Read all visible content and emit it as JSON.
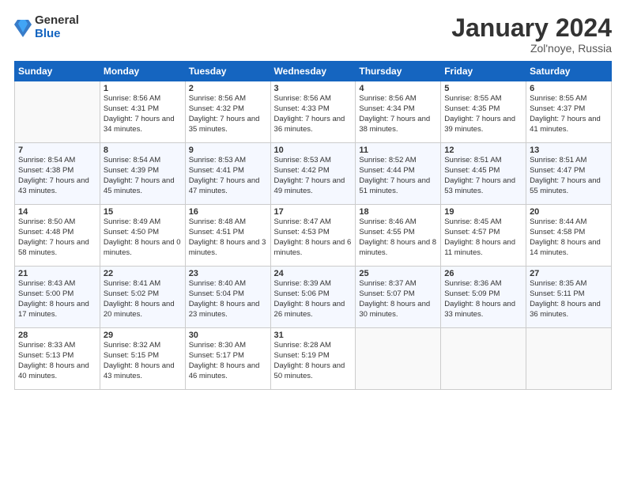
{
  "logo": {
    "general": "General",
    "blue": "Blue"
  },
  "title": "January 2024",
  "subtitle": "Zol'noye, Russia",
  "headers": [
    "Sunday",
    "Monday",
    "Tuesday",
    "Wednesday",
    "Thursday",
    "Friday",
    "Saturday"
  ],
  "weeks": [
    [
      {
        "day": "",
        "sunrise": "",
        "sunset": "",
        "daylight": "",
        "empty": true
      },
      {
        "day": "1",
        "sunrise": "Sunrise: 8:56 AM",
        "sunset": "Sunset: 4:31 PM",
        "daylight": "Daylight: 7 hours and 34 minutes."
      },
      {
        "day": "2",
        "sunrise": "Sunrise: 8:56 AM",
        "sunset": "Sunset: 4:32 PM",
        "daylight": "Daylight: 7 hours and 35 minutes."
      },
      {
        "day": "3",
        "sunrise": "Sunrise: 8:56 AM",
        "sunset": "Sunset: 4:33 PM",
        "daylight": "Daylight: 7 hours and 36 minutes."
      },
      {
        "day": "4",
        "sunrise": "Sunrise: 8:56 AM",
        "sunset": "Sunset: 4:34 PM",
        "daylight": "Daylight: 7 hours and 38 minutes."
      },
      {
        "day": "5",
        "sunrise": "Sunrise: 8:55 AM",
        "sunset": "Sunset: 4:35 PM",
        "daylight": "Daylight: 7 hours and 39 minutes."
      },
      {
        "day": "6",
        "sunrise": "Sunrise: 8:55 AM",
        "sunset": "Sunset: 4:37 PM",
        "daylight": "Daylight: 7 hours and 41 minutes."
      }
    ],
    [
      {
        "day": "7",
        "sunrise": "Sunrise: 8:54 AM",
        "sunset": "Sunset: 4:38 PM",
        "daylight": "Daylight: 7 hours and 43 minutes."
      },
      {
        "day": "8",
        "sunrise": "Sunrise: 8:54 AM",
        "sunset": "Sunset: 4:39 PM",
        "daylight": "Daylight: 7 hours and 45 minutes."
      },
      {
        "day": "9",
        "sunrise": "Sunrise: 8:53 AM",
        "sunset": "Sunset: 4:41 PM",
        "daylight": "Daylight: 7 hours and 47 minutes."
      },
      {
        "day": "10",
        "sunrise": "Sunrise: 8:53 AM",
        "sunset": "Sunset: 4:42 PM",
        "daylight": "Daylight: 7 hours and 49 minutes."
      },
      {
        "day": "11",
        "sunrise": "Sunrise: 8:52 AM",
        "sunset": "Sunset: 4:44 PM",
        "daylight": "Daylight: 7 hours and 51 minutes."
      },
      {
        "day": "12",
        "sunrise": "Sunrise: 8:51 AM",
        "sunset": "Sunset: 4:45 PM",
        "daylight": "Daylight: 7 hours and 53 minutes."
      },
      {
        "day": "13",
        "sunrise": "Sunrise: 8:51 AM",
        "sunset": "Sunset: 4:47 PM",
        "daylight": "Daylight: 7 hours and 55 minutes."
      }
    ],
    [
      {
        "day": "14",
        "sunrise": "Sunrise: 8:50 AM",
        "sunset": "Sunset: 4:48 PM",
        "daylight": "Daylight: 7 hours and 58 minutes."
      },
      {
        "day": "15",
        "sunrise": "Sunrise: 8:49 AM",
        "sunset": "Sunset: 4:50 PM",
        "daylight": "Daylight: 8 hours and 0 minutes."
      },
      {
        "day": "16",
        "sunrise": "Sunrise: 8:48 AM",
        "sunset": "Sunset: 4:51 PM",
        "daylight": "Daylight: 8 hours and 3 minutes."
      },
      {
        "day": "17",
        "sunrise": "Sunrise: 8:47 AM",
        "sunset": "Sunset: 4:53 PM",
        "daylight": "Daylight: 8 hours and 6 minutes."
      },
      {
        "day": "18",
        "sunrise": "Sunrise: 8:46 AM",
        "sunset": "Sunset: 4:55 PM",
        "daylight": "Daylight: 8 hours and 8 minutes."
      },
      {
        "day": "19",
        "sunrise": "Sunrise: 8:45 AM",
        "sunset": "Sunset: 4:57 PM",
        "daylight": "Daylight: 8 hours and 11 minutes."
      },
      {
        "day": "20",
        "sunrise": "Sunrise: 8:44 AM",
        "sunset": "Sunset: 4:58 PM",
        "daylight": "Daylight: 8 hours and 14 minutes."
      }
    ],
    [
      {
        "day": "21",
        "sunrise": "Sunrise: 8:43 AM",
        "sunset": "Sunset: 5:00 PM",
        "daylight": "Daylight: 8 hours and 17 minutes."
      },
      {
        "day": "22",
        "sunrise": "Sunrise: 8:41 AM",
        "sunset": "Sunset: 5:02 PM",
        "daylight": "Daylight: 8 hours and 20 minutes."
      },
      {
        "day": "23",
        "sunrise": "Sunrise: 8:40 AM",
        "sunset": "Sunset: 5:04 PM",
        "daylight": "Daylight: 8 hours and 23 minutes."
      },
      {
        "day": "24",
        "sunrise": "Sunrise: 8:39 AM",
        "sunset": "Sunset: 5:06 PM",
        "daylight": "Daylight: 8 hours and 26 minutes."
      },
      {
        "day": "25",
        "sunrise": "Sunrise: 8:37 AM",
        "sunset": "Sunset: 5:07 PM",
        "daylight": "Daylight: 8 hours and 30 minutes."
      },
      {
        "day": "26",
        "sunrise": "Sunrise: 8:36 AM",
        "sunset": "Sunset: 5:09 PM",
        "daylight": "Daylight: 8 hours and 33 minutes."
      },
      {
        "day": "27",
        "sunrise": "Sunrise: 8:35 AM",
        "sunset": "Sunset: 5:11 PM",
        "daylight": "Daylight: 8 hours and 36 minutes."
      }
    ],
    [
      {
        "day": "28",
        "sunrise": "Sunrise: 8:33 AM",
        "sunset": "Sunset: 5:13 PM",
        "daylight": "Daylight: 8 hours and 40 minutes."
      },
      {
        "day": "29",
        "sunrise": "Sunrise: 8:32 AM",
        "sunset": "Sunset: 5:15 PM",
        "daylight": "Daylight: 8 hours and 43 minutes."
      },
      {
        "day": "30",
        "sunrise": "Sunrise: 8:30 AM",
        "sunset": "Sunset: 5:17 PM",
        "daylight": "Daylight: 8 hours and 46 minutes."
      },
      {
        "day": "31",
        "sunrise": "Sunrise: 8:28 AM",
        "sunset": "Sunset: 5:19 PM",
        "daylight": "Daylight: 8 hours and 50 minutes."
      },
      {
        "day": "",
        "sunrise": "",
        "sunset": "",
        "daylight": "",
        "empty": true
      },
      {
        "day": "",
        "sunrise": "",
        "sunset": "",
        "daylight": "",
        "empty": true
      },
      {
        "day": "",
        "sunrise": "",
        "sunset": "",
        "daylight": "",
        "empty": true
      }
    ]
  ]
}
